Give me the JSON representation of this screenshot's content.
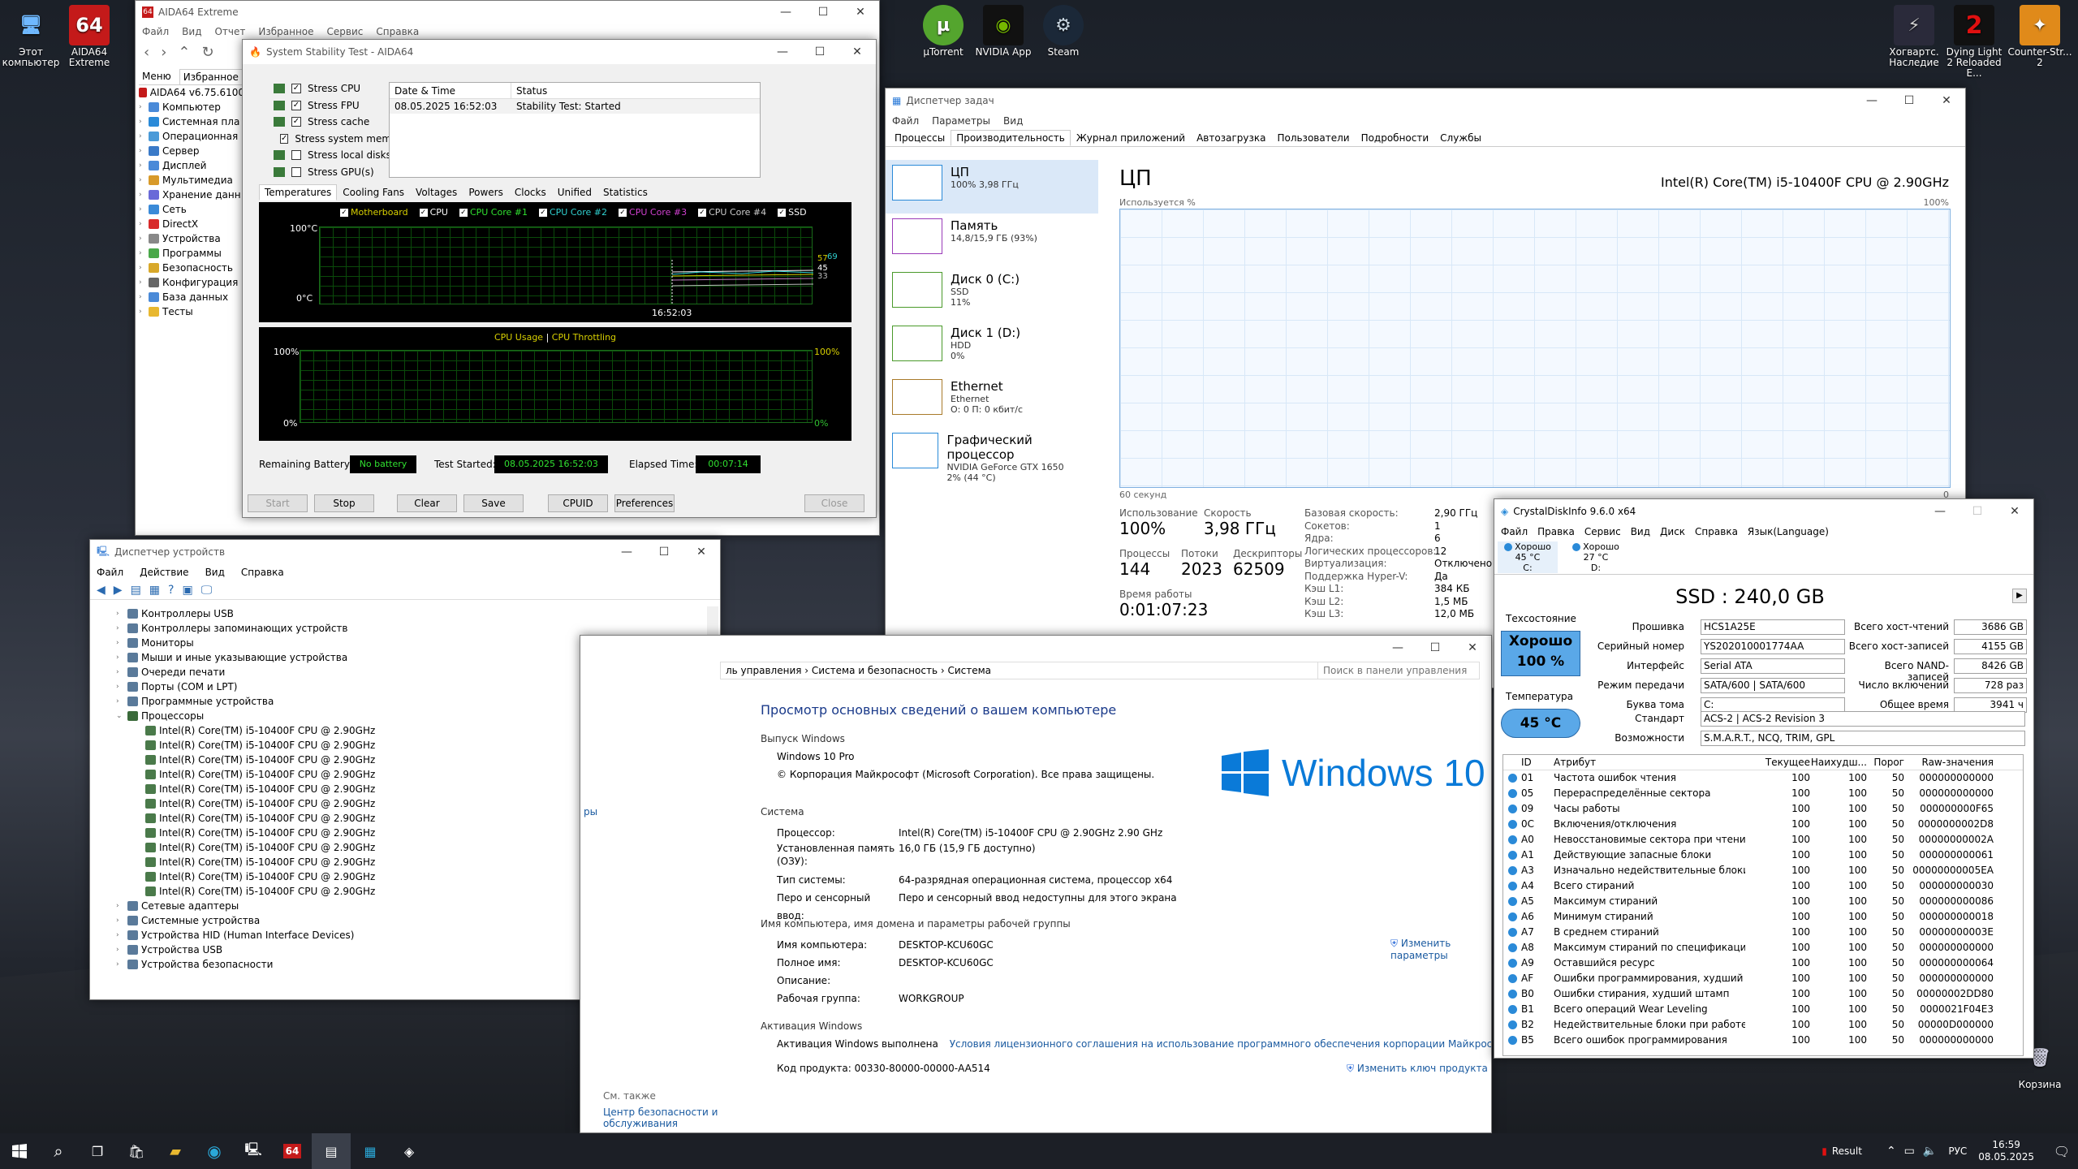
{
  "desktop": {
    "icons_left": [
      {
        "label": "Этот компьютер",
        "icon": "computer-icon"
      },
      {
        "label": "AIDA64 Extreme",
        "icon": "aida64-icon"
      }
    ],
    "icons_top": [
      {
        "label": "µTorrent"
      },
      {
        "label": "NVIDIA App"
      },
      {
        "label": "Steam"
      }
    ],
    "icons_right": [
      {
        "label": "Хогвартс. Наследие"
      },
      {
        "label": "Dying Light 2 Reloaded E..."
      },
      {
        "label": "Counter-Str... 2"
      }
    ],
    "recycle": "Корзина"
  },
  "aida": {
    "title": "AIDA64 Extreme",
    "menu": [
      "Файл",
      "Вид",
      "Отчет",
      "Избранное",
      "Сервис",
      "Справка"
    ],
    "tabs": [
      "Меню",
      "Избранное"
    ],
    "tree": [
      "AIDA64 v6.75.6100",
      "Компьютер",
      "Системная пла",
      "Операционная",
      "Сервер",
      "Дисплей",
      "Мультимедиа",
      "Хранение данн",
      "Сеть",
      "DirectX",
      "Устройства",
      "Программы",
      "Безопасность",
      "Конфигурация",
      "База данных",
      "Тесты"
    ]
  },
  "sst": {
    "title": "System Stability Test - AIDA64",
    "stress": [
      {
        "label": "Stress CPU",
        "checked": true
      },
      {
        "label": "Stress FPU",
        "checked": true
      },
      {
        "label": "Stress cache",
        "checked": true
      },
      {
        "label": "Stress system memory",
        "checked": true
      },
      {
        "label": "Stress local disks",
        "checked": false
      },
      {
        "label": "Stress GPU(s)",
        "checked": false
      }
    ],
    "log_headers": [
      "Date & Time",
      "Status"
    ],
    "log_row": [
      "08.05.2025 16:52:03",
      "Stability Test: Started"
    ],
    "tabs": [
      "Temperatures",
      "Cooling Fans",
      "Voltages",
      "Powers",
      "Clocks",
      "Unified",
      "Statistics"
    ],
    "legend": [
      "Motherboard",
      "CPU",
      "CPU Core #1",
      "CPU Core #2",
      "CPU Core #3",
      "CPU Core #4",
      "SSD"
    ],
    "temp_top": "100°C",
    "temp_bottom": "0°C",
    "temp_time": "16:52:03",
    "temp_vals": [
      "57",
      "69",
      "45",
      "33"
    ],
    "usage_title": "CPU Usage",
    "throttle_title": "CPU Throttling",
    "pct_top": "100%",
    "pct_bottom": "0%",
    "remaining_label": "Remaining Battery:",
    "remaining_val": "No battery",
    "started_label": "Test Started:",
    "started_val": "08.05.2025 16:52:03",
    "elapsed_label": "Elapsed Time:",
    "elapsed_val": "00:07:14",
    "buttons": [
      "Start",
      "Stop",
      "Clear",
      "Save",
      "CPUID",
      "Preferences",
      "Close"
    ]
  },
  "tm": {
    "title": "Диспетчер задач",
    "menu": [
      "Файл",
      "Параметры",
      "Вид"
    ],
    "tabs": [
      "Процессы",
      "Производительность",
      "Журнал приложений",
      "Автозагрузка",
      "Пользователи",
      "Подробности",
      "Службы"
    ],
    "items": [
      {
        "name": "ЦП",
        "sub": "100% 3,98 ГГц",
        "sub2": ""
      },
      {
        "name": "Память",
        "sub": "14,8/15,9 ГБ (93%)",
        "sub2": ""
      },
      {
        "name": "Диск 0 (C:)",
        "sub": "SSD",
        "sub2": "11%"
      },
      {
        "name": "Диск 1 (D:)",
        "sub": "HDD",
        "sub2": "0%"
      },
      {
        "name": "Ethernet",
        "sub": "Ethernet",
        "sub2": "О: 0 П: 0 кбит/с"
      },
      {
        "name": "Графический процессор",
        "sub": "NVIDIA GeForce GTX 1650",
        "sub2": "2% (44 °C)"
      }
    ],
    "heading": "ЦП",
    "cpu_name": "Intel(R) Core(TM) i5-10400F CPU @ 2.90GHz",
    "graph_label": "Используется %",
    "graph_max": "100%",
    "graph_time": "60 секунд",
    "graph_min": "0",
    "stats": [
      {
        "label": "Использование",
        "value": "100%"
      },
      {
        "label": "Скорость",
        "value": "3,98 ГГц"
      },
      {
        "label": "Процессы",
        "value": "144"
      },
      {
        "label": "Потоки",
        "value": "2023"
      },
      {
        "label": "Дескрипторы",
        "value": "62509"
      },
      {
        "label": "Время работы",
        "value": "0:01:07:23"
      }
    ],
    "details": [
      [
        "Базовая скорость:",
        "2,90 ГГц"
      ],
      [
        "Сокетов:",
        "1"
      ],
      [
        "Ядра:",
        "6"
      ],
      [
        "Логических процессоров:",
        "12"
      ],
      [
        "Виртуализация:",
        "Отключено"
      ],
      [
        "Поддержка Hyper-V:",
        "Да"
      ],
      [
        "Кэш L1:",
        "384 КБ"
      ],
      [
        "Кэш L2:",
        "1,5 МБ"
      ],
      [
        "Кэш L3:",
        "12,0 МБ"
      ]
    ]
  },
  "dm": {
    "title": "Диспетчер устройств",
    "menu": [
      "Файл",
      "Действие",
      "Вид",
      "Справка"
    ],
    "tree_before": [
      "Контроллеры USB",
      "Контроллеры запоминающих устройств",
      "Мониторы",
      "Мыши и иные указывающие устройства",
      "Очереди печати",
      "Порты (COM и LPT)",
      "Программные устройства"
    ],
    "proc_group": "Процессоры",
    "cpu": "Intel(R) Core(TM) i5-10400F CPU @ 2.90GHz",
    "cpu_count": 12,
    "tree_after": [
      "Сетевые адаптеры",
      "Системные устройства",
      "Устройства HID (Human Interface Devices)",
      "Устройства USB",
      "Устройства безопасности"
    ]
  },
  "sys": {
    "breadcrumb": "ль управления  ›  Система и безопасность  ›  Система",
    "search_placeholder": "Поиск в панели управления",
    "heading": "Просмотр основных сведений о вашем компьютере",
    "sec_edition": "Выпуск Windows",
    "edition": "Windows 10 Pro",
    "copyright": "© Корпорация Майкрософт (Microsoft Corporation). Все права защищены.",
    "logo": "Windows 10",
    "sec_system": "Система",
    "system": [
      [
        "Процессор:",
        "Intel(R) Core(TM) i5-10400F CPU @ 2.90GHz   2.90 GHz"
      ],
      [
        "Установленная память (ОЗУ):",
        "16,0 ГБ (15,9 ГБ доступно)"
      ],
      [
        "Тип системы:",
        "64-разрядная операционная система, процессор x64"
      ],
      [
        "Перо и сенсорный ввод:",
        "Перо и сенсорный ввод недоступны для этого экрана"
      ]
    ],
    "sec_name": "Имя компьютера, имя домена и параметры рабочей группы",
    "name": [
      [
        "Имя компьютера:",
        "DESKTOP-KCU60GC"
      ],
      [
        "Полное имя:",
        "DESKTOP-KCU60GC"
      ],
      [
        "Описание:",
        ""
      ],
      [
        "Рабочая группа:",
        "WORKGROUP"
      ]
    ],
    "change": "Изменить параметры",
    "sec_act": "Активация Windows",
    "act_label": "Активация Windows выполнена",
    "act_link": "Условия лицензионного соглашения на использование программного обеспечения корпорации Майкрософт",
    "product_label": "Код продукта: 00330-80000-00000-AA514",
    "change_key": "Изменить ключ продукта",
    "see_also": "См. также",
    "security": "Центр безопасности и обслуживания",
    "side_frag": "ры"
  },
  "cdi": {
    "title": "CrystalDiskInfo 9.6.0 x64",
    "menu": [
      "Файл",
      "Правка",
      "Сервис",
      "Вид",
      "Диск",
      "Справка",
      "Язык(Language)"
    ],
    "drives": [
      {
        "status": "Хорошо",
        "temp": "45 °C",
        "letter": "C:"
      },
      {
        "status": "Хорошо",
        "temp": "27 °C",
        "letter": "D:"
      }
    ],
    "model": "SSD : 240,0 GB",
    "tech_label": "Техсостояние",
    "health": "Хорошо",
    "health_pct": "100 %",
    "temp_label": "Температура",
    "temp": "45 °C",
    "fields": [
      [
        "Прошивка",
        "HCS1A25E"
      ],
      [
        "Серийный номер",
        "YS202010001774AA"
      ],
      [
        "Интерфейс",
        "Serial ATA"
      ],
      [
        "Режим передачи",
        "SATA/600 | SATA/600"
      ],
      [
        "Буква тома",
        "C:"
      ]
    ],
    "fields_r": [
      [
        "Всего хост-чтений",
        "3686 GB"
      ],
      [
        "Всего хост-записей",
        "4155 GB"
      ],
      [
        "Всего NAND-записей",
        "8426 GB"
      ],
      [
        "Число включений",
        "728 раз"
      ],
      [
        "Общее время работы",
        "3941 ч"
      ]
    ],
    "standard_label": "Стандарт",
    "standard": "ACS-2 | ACS-2 Revision 3",
    "features_label": "Возможности",
    "features": "S.M.A.R.T., NCQ, TRIM, GPL",
    "attr_headers": [
      "ID",
      "Атрибут",
      "Текущее",
      "Наихудш...",
      "Порог",
      "Raw-значения"
    ],
    "attrs": [
      [
        "01",
        "Частота ошибок чтения",
        "100",
        "100",
        "50",
        "000000000000"
      ],
      [
        "05",
        "Перераспределённые сектора",
        "100",
        "100",
        "50",
        "000000000000"
      ],
      [
        "09",
        "Часы работы",
        "100",
        "100",
        "50",
        "000000000F65"
      ],
      [
        "0C",
        "Включения/отключения",
        "100",
        "100",
        "50",
        "0000000002D8"
      ],
      [
        "A0",
        "Невосстановимые сектора при чтении/за...",
        "100",
        "100",
        "50",
        "00000000002A"
      ],
      [
        "A1",
        "Действующие запасные блоки",
        "100",
        "100",
        "50",
        "000000000061"
      ],
      [
        "A3",
        "Изначально недействительные блоки",
        "100",
        "100",
        "50",
        "00000000005EA"
      ],
      [
        "A4",
        "Всего стираний",
        "100",
        "100",
        "50",
        "000000000030"
      ],
      [
        "A5",
        "Максимум стираний",
        "100",
        "100",
        "50",
        "000000000086"
      ],
      [
        "A6",
        "Минимум стираний",
        "100",
        "100",
        "50",
        "000000000018"
      ],
      [
        "A7",
        "В среднем стираний",
        "100",
        "100",
        "50",
        "00000000003E"
      ],
      [
        "A8",
        "Максимум стираний по спецификации",
        "100",
        "100",
        "50",
        "000000000000"
      ],
      [
        "A9",
        "Оставшийся ресурс",
        "100",
        "100",
        "50",
        "000000000064"
      ],
      [
        "AF",
        "Ошибки программирования, худший шта...",
        "100",
        "100",
        "50",
        "000000000000"
      ],
      [
        "B0",
        "Ошибки стирания, худший штамп",
        "100",
        "100",
        "50",
        "00000002DD80"
      ],
      [
        "B1",
        "Всего операций Wear Leveling",
        "100",
        "100",
        "50",
        "0000021F04E3"
      ],
      [
        "B2",
        "Недействительные блоки при работе",
        "100",
        "100",
        "50",
        "00000D000000"
      ],
      [
        "B5",
        "Всего ошибок программирования",
        "100",
        "100",
        "50",
        "000000000000"
      ]
    ]
  },
  "taskbar": {
    "result": "Result",
    "lang": "РУС",
    "time": "16:59",
    "date": "08.05.2025"
  }
}
